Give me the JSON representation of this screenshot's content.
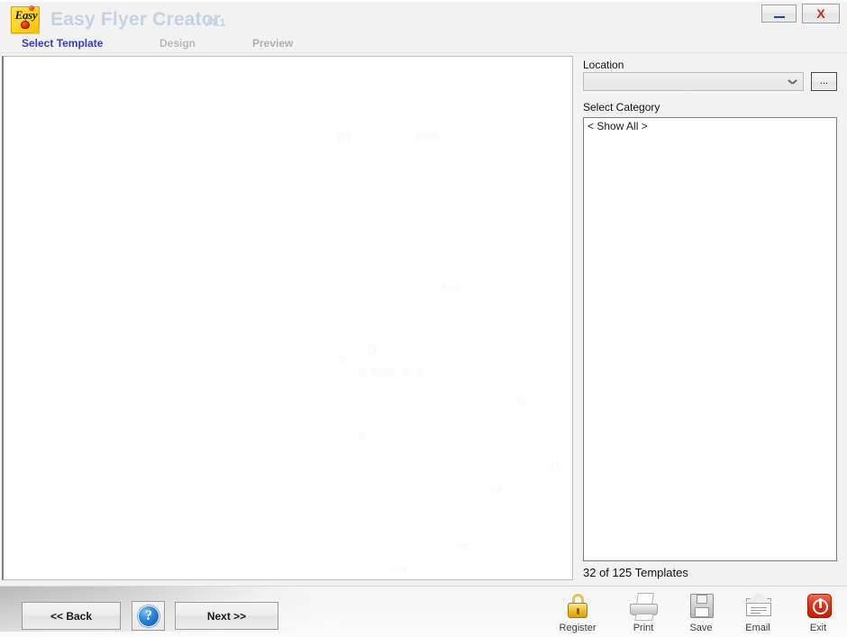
{
  "window": {
    "title": "Easy Flyer Creator",
    "version": "V4.1",
    "logo_word": "Easy",
    "minimize_label": "_",
    "close_label": "X",
    "minimize_icon": "minimize-icon",
    "close_icon": "close-icon"
  },
  "steps": [
    {
      "label": "Select Template",
      "state": "active"
    },
    {
      "label": "Design",
      "state": "inactive"
    },
    {
      "label": "Preview",
      "state": "inactive"
    }
  ],
  "sidebar": {
    "location_label": "Location",
    "location_value": "",
    "location_placeholder": "",
    "browse_label": "...",
    "browse_icon": "ellipsis-icon",
    "dropdown_icon": "chevron-down-icon",
    "category_label": "Select Category",
    "categories": [
      "< Show All >"
    ],
    "template_count": "32 of 125 Templates"
  },
  "navigation": {
    "back_label": "<< Back",
    "help_label": "?",
    "help_icon": "help-circle-icon",
    "next_label": "Next >>"
  },
  "toolbar": [
    {
      "label": "Register",
      "icon": "padlock-icon"
    },
    {
      "label": "Print",
      "icon": "printer-icon"
    },
    {
      "label": "Save",
      "icon": "floppy-disk-icon"
    },
    {
      "label": "Email",
      "icon": "envelope-icon"
    },
    {
      "label": "Exit",
      "icon": "power-off-icon"
    }
  ],
  "colors": {
    "title_text": "#c6d1e2",
    "active_step": "#3b3bc6",
    "inactive_step": "#b8b8b8",
    "close_x": "#cf2222",
    "minimize_dash": "#2b3ea0",
    "exit_icon": "#e03418",
    "register_icon": "#f0c23c",
    "help_icon": "#2a82d8",
    "header_bg": "#f2f2f2",
    "panel_bg": "#ffffff"
  }
}
